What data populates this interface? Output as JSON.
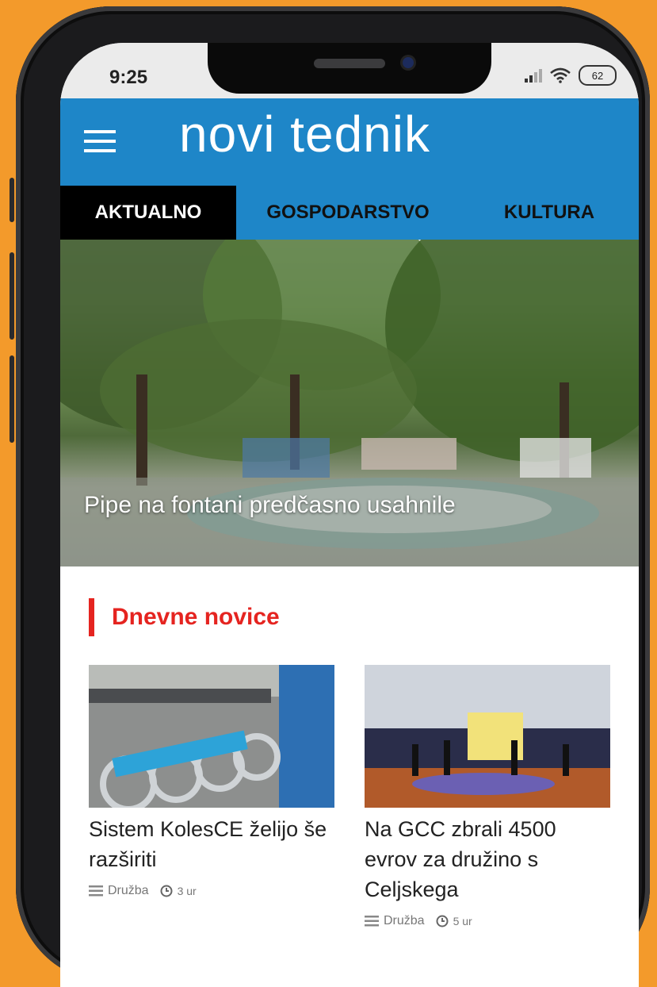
{
  "status": {
    "time": "9:25",
    "battery": "62"
  },
  "brand": {
    "name": "novi tednik"
  },
  "tabs": [
    {
      "label": "AKTUALNO",
      "active": true
    },
    {
      "label": "GOSPODARSTVO",
      "active": false
    },
    {
      "label": "KULTURA",
      "active": false
    }
  ],
  "hero": {
    "caption": "Pipe na fontani predčasno usahnile"
  },
  "section": {
    "title": "Dnevne novice"
  },
  "articles": [
    {
      "title": "Sistem KolesCE želijo še razširiti",
      "category": "Družba",
      "time": "3 ur"
    },
    {
      "title": "Na GCC zbrali 4500 evrov za družino s Celjskega",
      "category": "Družba",
      "time": "5 ur"
    }
  ],
  "colors": {
    "background": "#f39a2b",
    "brand": "#1e86c8",
    "accent": "#e52420"
  }
}
